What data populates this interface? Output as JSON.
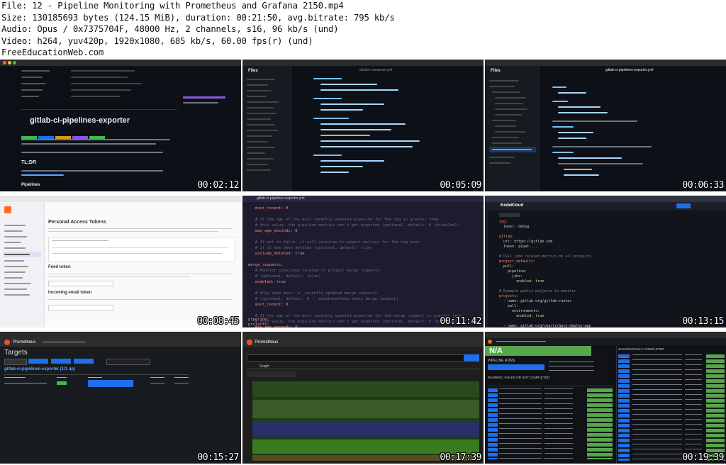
{
  "header": {
    "file": "File: 12 - Pipeline Monitoring with Prometheus and Grafana 2150.mp4",
    "size": "Size: 130185693 bytes (124.15 MiB), duration: 00:21:50, avg.bitrate: 795 kb/s",
    "audio": "Audio: Opus / 0x7375704F, 48000 Hz, 2 channels, s16, 96 kb/s (und)",
    "video": "Video: h264, yuv420p, 1920x1080, 685 kb/s, 60.00 fps(r) (und)",
    "site": "FreeEducationWeb.com"
  },
  "thumbnails": [
    {
      "timestamp": "00:02:12",
      "title": "gitlab-ci-pipelines-exporter",
      "subtitle": "TL;DR",
      "section": "Pipelines"
    },
    {
      "timestamp": "00:05:09",
      "title": "docker-compose.yml",
      "panel": "Files"
    },
    {
      "timestamp": "00:06:33",
      "title": "gitlab-ci-pipelines-exporter.yml",
      "panel": "Files"
    },
    {
      "timestamp": "00:08:45",
      "title": "Personal Access Tokens",
      "section2": "Feed token",
      "section3": "Incoming email token"
    },
    {
      "timestamp": "00:11:42",
      "title": "gitlab-ci-pipelines-exporter.yml",
      "code": "merge_requests:",
      "code2": "pipeline:",
      "code3": "projects:"
    },
    {
      "timestamp": "00:13:15",
      "title": "KodeKloud",
      "code": "log:",
      "code2": "level: debug"
    },
    {
      "timestamp": "00:15:27",
      "title": "Targets",
      "app": "Prometheus",
      "target": "gitlab-ci-pipelines-exporter (1/1 up)"
    },
    {
      "timestamp": "00:17:39",
      "title": "Graph",
      "app": "Prometheus"
    },
    {
      "timestamp": "00:19:39",
      "title": "N/A",
      "section": "RUNNING, FAILED OR NOT COMPLETED",
      "section2": "SUCCESSFULLY COMPLETED",
      "section3": "PIPELINE RUNS"
    }
  ]
}
